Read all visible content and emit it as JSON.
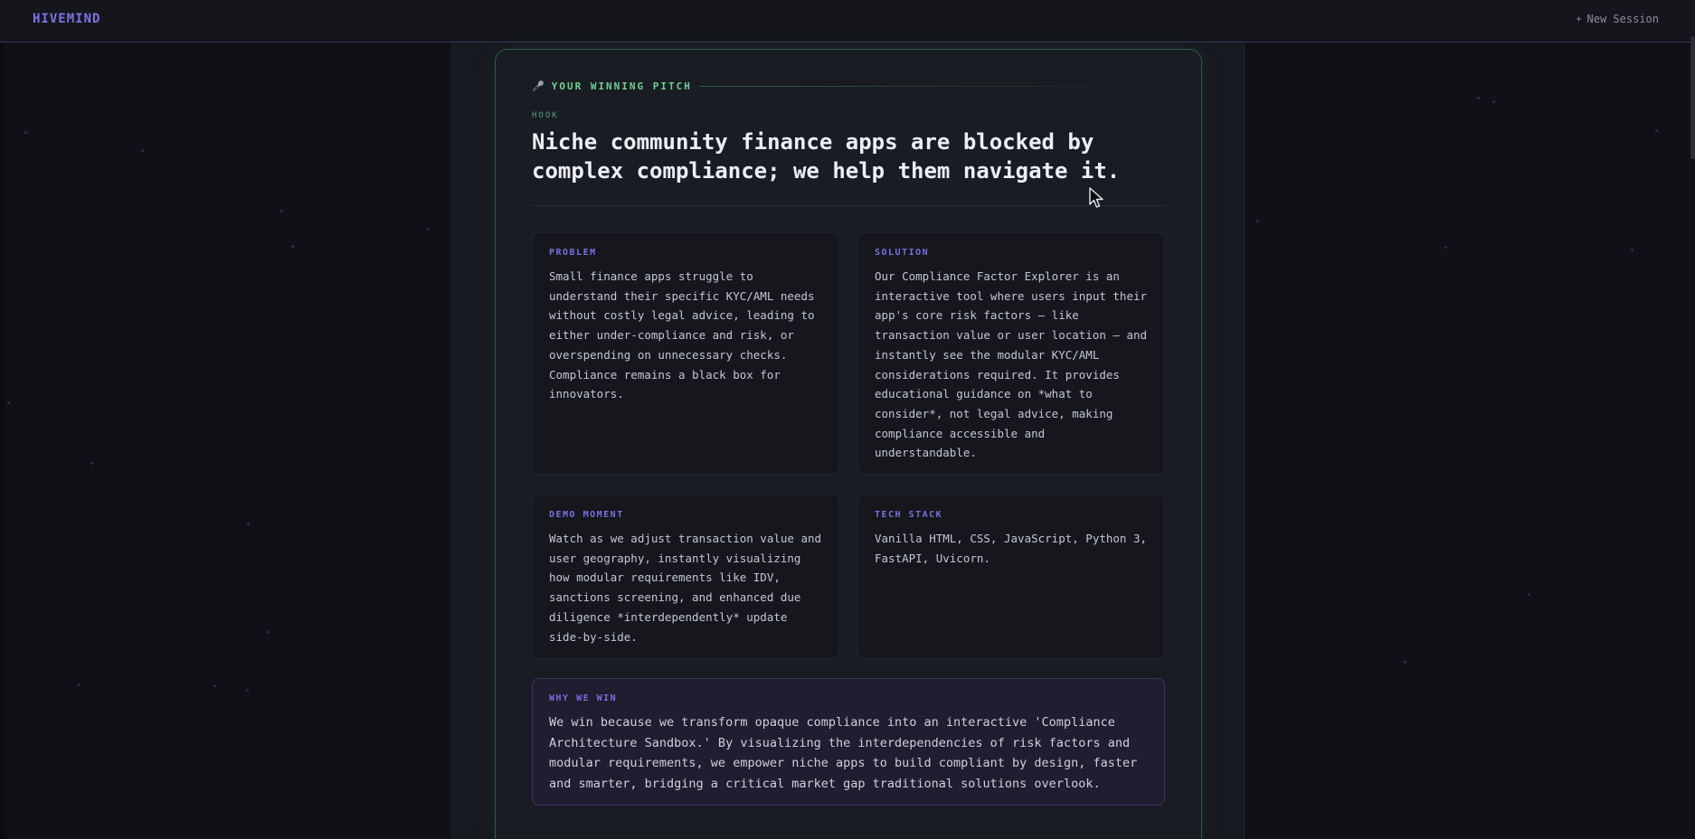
{
  "app": {
    "brand": "HIVEMIND",
    "new_session_label": "New Session",
    "new_session_icon": "plus-icon"
  },
  "pitch": {
    "section_label": "YOUR WINNING PITCH",
    "section_icon": "microphone-icon",
    "hook_label": "HOOK",
    "hook_text": "Niche community finance apps are blocked by complex compliance; we help them navigate it.",
    "problem": {
      "title": "PROBLEM",
      "body": "Small finance apps struggle to understand their specific KYC/AML needs without costly legal advice, leading to either under-compliance and risk, or overspending on unnecessary checks. Compliance remains a black box for innovators."
    },
    "solution": {
      "title": "SOLUTION",
      "body": "Our Compliance Factor Explorer is an interactive tool where users input their app's core risk factors – like transaction value or user location – and instantly see the modular KYC/AML considerations required. It provides educational guidance on *what to consider*, not legal advice, making compliance accessible and understandable."
    },
    "demo": {
      "title": "DEMO MOMENT",
      "body": "Watch as we adjust transaction value and user geography, instantly visualizing how modular requirements like IDV, sanctions screening, and enhanced due diligence *interdependently* update side-by-side."
    },
    "tech": {
      "title": "TECH STACK",
      "body": "Vanilla HTML, CSS, JavaScript, Python 3, FastAPI, Uvicorn."
    },
    "why": {
      "title": "WHY WE WIN",
      "body": "We win because we transform opaque compliance into an interactive 'Compliance Architecture Sandbox.' By visualizing the interdependencies of risk factors and modular requirements, we empower niche apps to build compliant by design, faster and smarter, bridging a critical market gap traditional solutions overlook."
    }
  },
  "colors": {
    "accent_purple": "#7d72e6",
    "accent_green": "#6fcf93",
    "background": "#101116",
    "card_border": "#2f5b45"
  }
}
